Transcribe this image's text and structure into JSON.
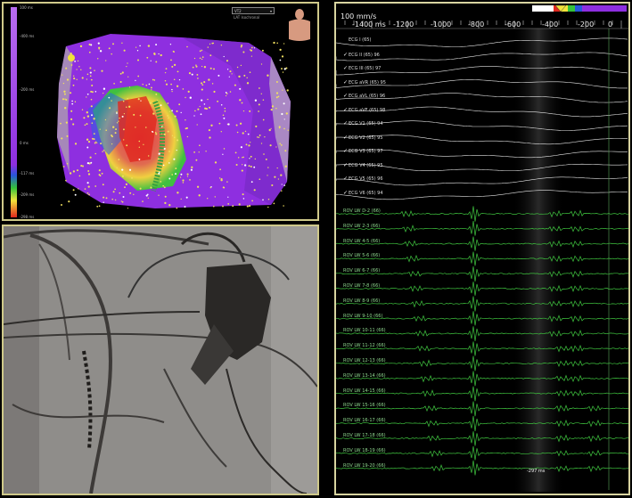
{
  "map": {
    "select_value": "VT2",
    "mode_label": "LAT Isochronal",
    "scale_ticks": [
      "100 ms",
      "-400 ms",
      "-200 ms",
      "0 ms",
      "-117 ms",
      "-209 ms",
      "-298 ms"
    ],
    "colors": {
      "purple": "#8e2fe0",
      "red": "#e0281e",
      "yellow": "#f2e23a",
      "green": "#34c23a",
      "blue": "#2856d8",
      "cyan": "#3ad0e8"
    }
  },
  "traces": {
    "sweep_label": "100 mm/s",
    "time_ticks": [
      "-1400 ms",
      "-1200",
      "-1000",
      "-800",
      "-600",
      "-400",
      "-200",
      "0"
    ],
    "cursor_label": "-297 ms",
    "ecg": [
      {
        "label": "ECG I (65)",
        "value": ""
      },
      {
        "label": "ECG II (65)",
        "value": "96"
      },
      {
        "label": "ECG III (65)",
        "value": "97"
      },
      {
        "label": "ECG aVR (65)",
        "value": "95"
      },
      {
        "label": "ECG aVL (65)",
        "value": "96"
      },
      {
        "label": "ECG aVF (65)",
        "value": "98"
      },
      {
        "label": "ECG V1 (65)",
        "value": "94"
      },
      {
        "label": "ECG V2 (65)",
        "value": "95"
      },
      {
        "label": "ECG V3 (65)",
        "value": "97"
      },
      {
        "label": "ECG V4 (65)",
        "value": "95"
      },
      {
        "label": "ECG V5 (65)",
        "value": "96"
      },
      {
        "label": "ECG V6 (65)",
        "value": "94"
      }
    ],
    "egm": [
      "ROV LW D-2 (66)",
      "ROV LW 2-3 (66)",
      "ROV LW 4-5 (66)",
      "ROV LW 5-6 (66)",
      "ROV LW 6-7 (66)",
      "ROV LW 7-8 (66)",
      "ROV LW 8-9 (66)",
      "ROV LW 9-10 (66)",
      "ROV LW 10-11 (66)",
      "ROV LW 11-12 (66)",
      "ROV LW 12-13 (66)",
      "ROV LW 13-14 (66)",
      "ROV LW 14-15 (66)",
      "ROV LW 15-16 (66)",
      "ROV LW 16-17 (66)",
      "ROV LW 17-18 (66)",
      "ROV LW 18-19 (66)",
      "ROV LW 19-20 (66)"
    ]
  }
}
